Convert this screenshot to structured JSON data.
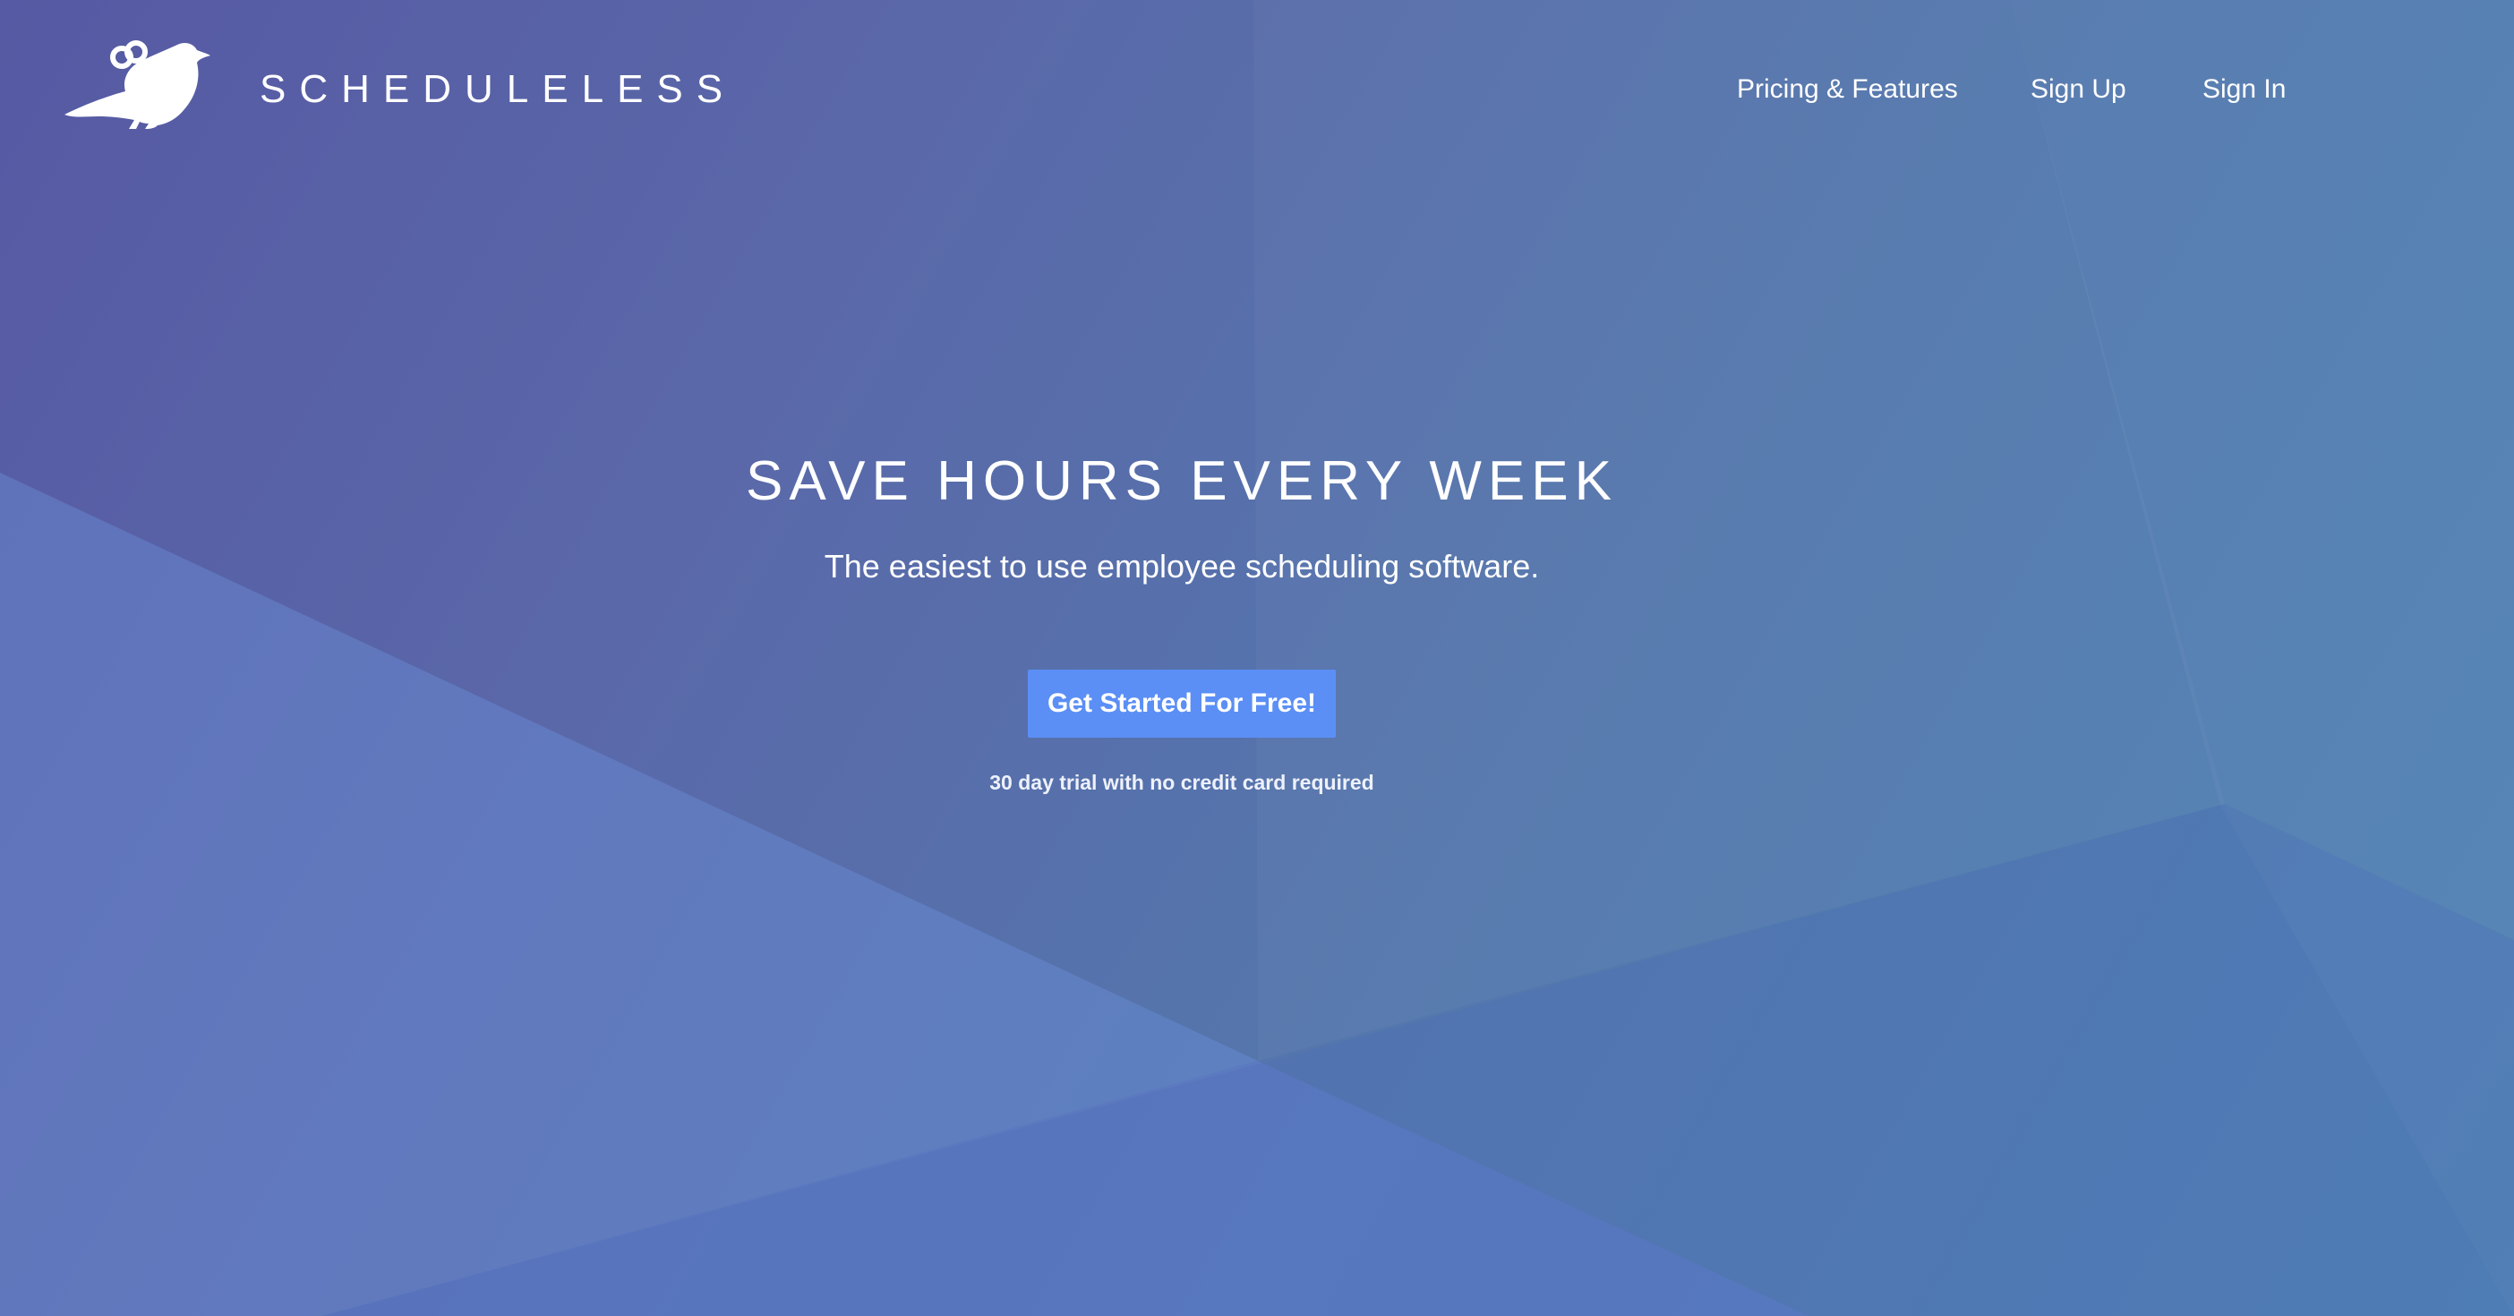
{
  "brand": {
    "name": "SCHEDULELESS",
    "logo_icon": "bird-icon"
  },
  "nav": {
    "items": [
      {
        "label": "Pricing & Features"
      },
      {
        "label": "Sign Up"
      },
      {
        "label": "Sign In"
      }
    ]
  },
  "hero": {
    "headline": "SAVE HOURS EVERY WEEK",
    "subheadline": "The easiest to use employee scheduling software.",
    "cta_label": "Get Started For Free!",
    "note": "30 day trial with no credit card required"
  },
  "colors": {
    "background_start": "#5659a3",
    "background_end": "#4f83b4",
    "cta_background": "#5b8ff5",
    "text": "#ffffff"
  }
}
